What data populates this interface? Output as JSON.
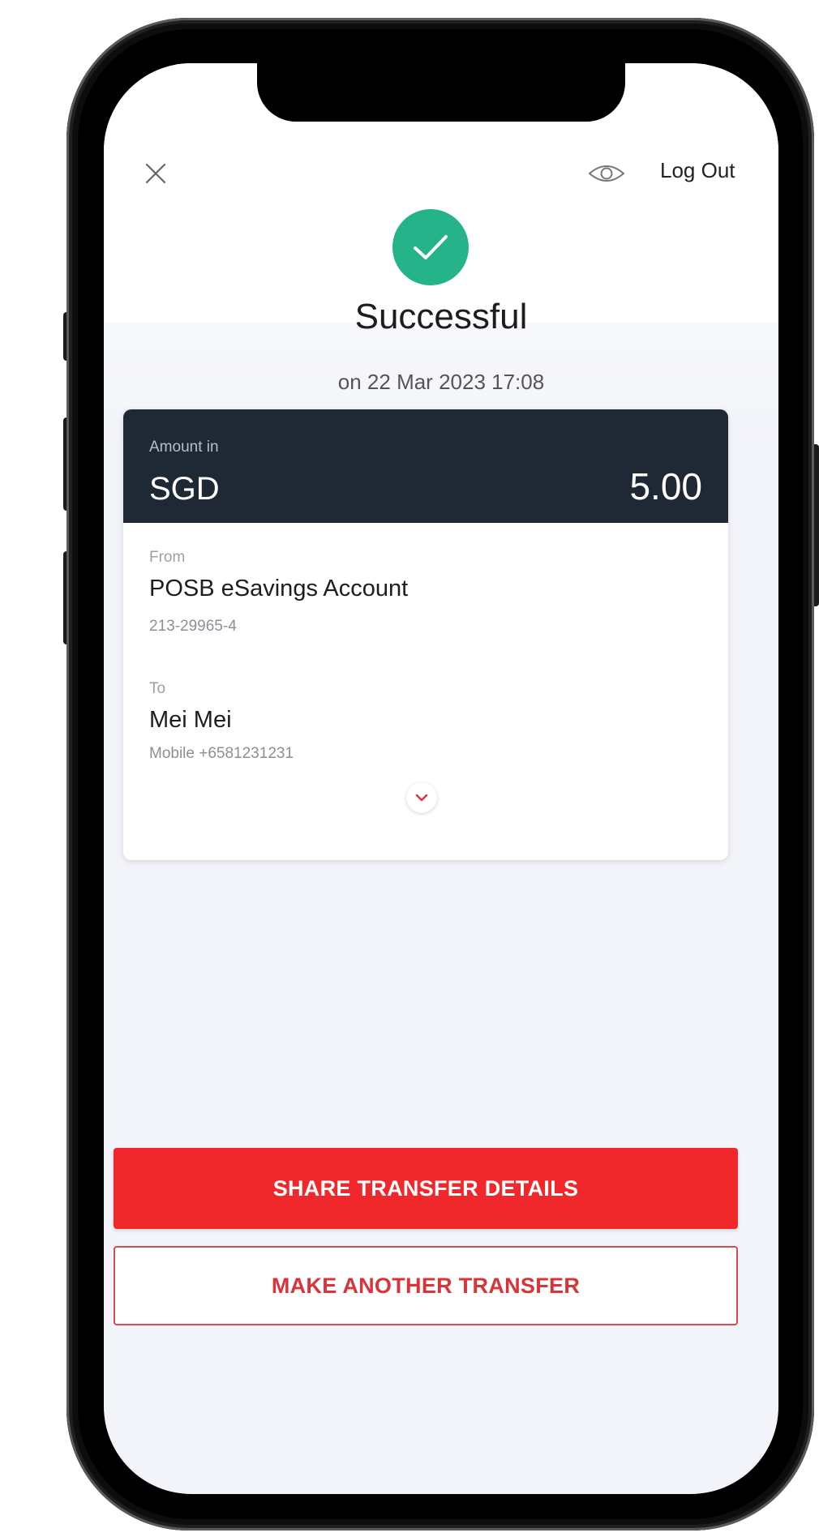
{
  "header": {
    "close_icon": "close-icon",
    "visibility_icon": "eye-icon",
    "logout_label": "Log Out"
  },
  "status": {
    "icon": "check-circle-icon",
    "title": "Successful",
    "date": "on 22 Mar 2023 17:08"
  },
  "transfer": {
    "amount_label": "Amount in",
    "currency": "SGD",
    "amount": "5.00",
    "from_label": "From",
    "from_account_name": "POSB eSavings Account",
    "from_account_number": "213-29965-4",
    "to_label": "To",
    "to_name": "Mei Mei",
    "to_detail": "Mobile +6581231231",
    "expand_icon": "chevron-down-icon"
  },
  "actions": {
    "share_label": "SHARE TRANSFER DETAILS",
    "another_label": "MAKE ANOTHER TRANSFER"
  },
  "colors": {
    "success": "#25b38a",
    "card_header": "#1f2935",
    "primary_red": "#f0282b",
    "screen_bg": "#f3f4fa"
  }
}
